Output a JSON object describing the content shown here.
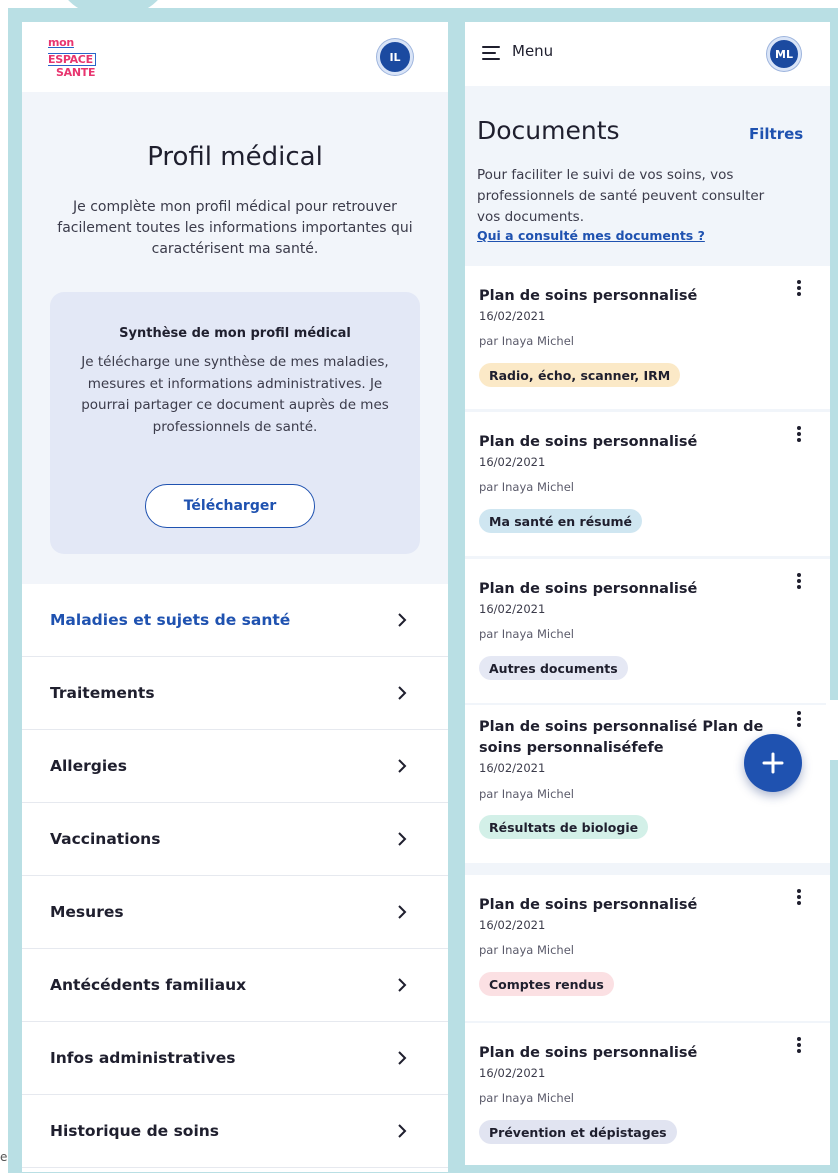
{
  "left": {
    "logo": {
      "line1": "mon",
      "line2": "ESPACE",
      "line3": "SANTE"
    },
    "avatar_initials": "IL",
    "hero": {
      "title": "Profil médical",
      "description": "Je complète mon profil médical pour retrouver facilement toutes les informations importantes qui caractérisent ma santé."
    },
    "synthesis": {
      "title": "Synthèse de mon profil médical",
      "text": "Je télécharge une synthèse de mes maladies, mesures et informations administratives. Je pourrai partager ce document auprès de mes professionnels de santé.",
      "button": "Télécharger"
    },
    "menu": [
      {
        "label": "Maladies et sujets de santé",
        "active": true
      },
      {
        "label": "Traitements"
      },
      {
        "label": "Allergies"
      },
      {
        "label": "Vaccinations"
      },
      {
        "label": "Mesures"
      },
      {
        "label": "Antécédents familiaux"
      },
      {
        "label": "Infos administratives"
      },
      {
        "label": "Historique de soins"
      }
    ]
  },
  "right": {
    "menu_label": "Menu",
    "avatar_initials": "ML",
    "documents": {
      "title": "Documents",
      "filters": "Filtres",
      "description": "Pour faciliter le suivi de vos soins, vos professionnels de santé peuvent consulter vos documents.",
      "link": "Qui a consulté mes documents ?"
    },
    "cards": [
      {
        "title": "Plan de soins personnalisé",
        "date": "16/02/2021",
        "author": "par Inaya Michel",
        "tag": "Radio, écho, scanner, IRM",
        "tag_color": "#fbe9c7"
      },
      {
        "title": "Plan de soins personnalisé",
        "date": "16/02/2021",
        "author": "par Inaya Michel",
        "tag": "Ma santé en résumé",
        "tag_color": "#cfe6f1"
      },
      {
        "title": "Plan de soins personnalisé",
        "date": "16/02/2021",
        "author": "par Inaya Michel",
        "tag": "Autres documents",
        "tag_color": "#e5e8f4"
      },
      {
        "title": "Plan de soins personnalisé Plan de soins personnaliséfefe",
        "date": "16/02/2021",
        "author": "par Inaya Michel",
        "tag": "Résultats de biologie",
        "tag_color": "#d3f0e8"
      },
      {
        "title": "Plan de soins personnalisé",
        "date": "16/02/2021",
        "author": "par Inaya Michel",
        "tag": "Comptes rendus",
        "tag_color": "#fbe0e3"
      },
      {
        "title": "Plan de soins personnalisé",
        "date": "16/02/2021",
        "author": "par Inaya Michel",
        "tag": "Prévention et dépistages",
        "tag_color": "#e1e4f1"
      }
    ],
    "fab_icon": "plus-icon"
  },
  "edge_text": "e",
  "colors": {
    "primary": "#1f52b0",
    "frame": "#b9dfe4",
    "hero_bg": "#f2f5fa"
  }
}
